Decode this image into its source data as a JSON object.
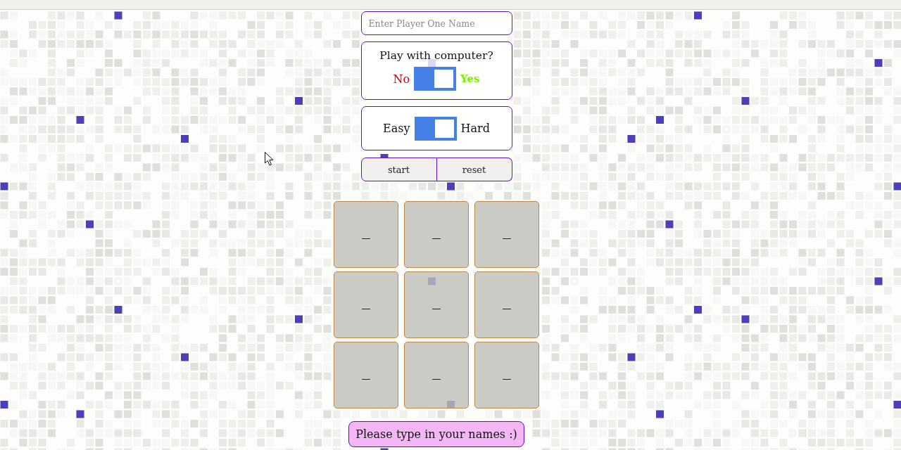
{
  "name_input": {
    "placeholder": "Enter Player One Name"
  },
  "computer_mode": {
    "question": "Play with computer?",
    "off_label": "No",
    "on_label": "Yes",
    "on": true
  },
  "difficulty": {
    "off_label": "Easy",
    "on_label": "Hard",
    "on": true
  },
  "buttons": [
    {
      "label": "start"
    },
    {
      "label": "reset"
    }
  ],
  "board": {
    "cells": [
      {
        "mark": "—"
      },
      {
        "mark": "—"
      },
      {
        "mark": "—"
      },
      {
        "mark": "—"
      },
      {
        "mark": "—"
      },
      {
        "mark": "—"
      },
      {
        "mark": "—"
      },
      {
        "mark": "—"
      },
      {
        "mark": "—"
      }
    ]
  },
  "message": "Please type in your names :)"
}
